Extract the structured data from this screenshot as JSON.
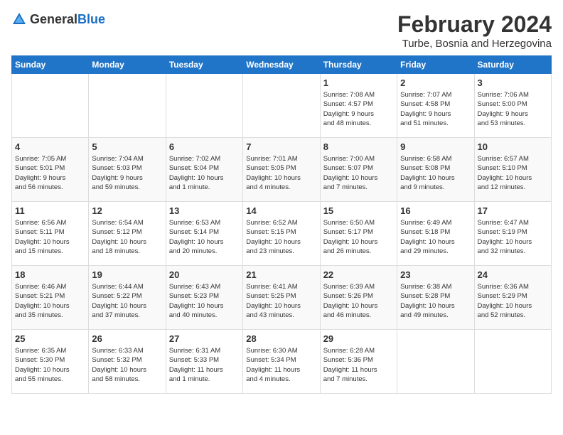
{
  "logo": {
    "general": "General",
    "blue": "Blue"
  },
  "title": "February 2024",
  "location": "Turbe, Bosnia and Herzegovina",
  "weekdays": [
    "Sunday",
    "Monday",
    "Tuesday",
    "Wednesday",
    "Thursday",
    "Friday",
    "Saturday"
  ],
  "weeks": [
    [
      {
        "day": "",
        "info": ""
      },
      {
        "day": "",
        "info": ""
      },
      {
        "day": "",
        "info": ""
      },
      {
        "day": "",
        "info": ""
      },
      {
        "day": "1",
        "info": "Sunrise: 7:08 AM\nSunset: 4:57 PM\nDaylight: 9 hours\nand 48 minutes."
      },
      {
        "day": "2",
        "info": "Sunrise: 7:07 AM\nSunset: 4:58 PM\nDaylight: 9 hours\nand 51 minutes."
      },
      {
        "day": "3",
        "info": "Sunrise: 7:06 AM\nSunset: 5:00 PM\nDaylight: 9 hours\nand 53 minutes."
      }
    ],
    [
      {
        "day": "4",
        "info": "Sunrise: 7:05 AM\nSunset: 5:01 PM\nDaylight: 9 hours\nand 56 minutes."
      },
      {
        "day": "5",
        "info": "Sunrise: 7:04 AM\nSunset: 5:03 PM\nDaylight: 9 hours\nand 59 minutes."
      },
      {
        "day": "6",
        "info": "Sunrise: 7:02 AM\nSunset: 5:04 PM\nDaylight: 10 hours\nand 1 minute."
      },
      {
        "day": "7",
        "info": "Sunrise: 7:01 AM\nSunset: 5:05 PM\nDaylight: 10 hours\nand 4 minutes."
      },
      {
        "day": "8",
        "info": "Sunrise: 7:00 AM\nSunset: 5:07 PM\nDaylight: 10 hours\nand 7 minutes."
      },
      {
        "day": "9",
        "info": "Sunrise: 6:58 AM\nSunset: 5:08 PM\nDaylight: 10 hours\nand 9 minutes."
      },
      {
        "day": "10",
        "info": "Sunrise: 6:57 AM\nSunset: 5:10 PM\nDaylight: 10 hours\nand 12 minutes."
      }
    ],
    [
      {
        "day": "11",
        "info": "Sunrise: 6:56 AM\nSunset: 5:11 PM\nDaylight: 10 hours\nand 15 minutes."
      },
      {
        "day": "12",
        "info": "Sunrise: 6:54 AM\nSunset: 5:12 PM\nDaylight: 10 hours\nand 18 minutes."
      },
      {
        "day": "13",
        "info": "Sunrise: 6:53 AM\nSunset: 5:14 PM\nDaylight: 10 hours\nand 20 minutes."
      },
      {
        "day": "14",
        "info": "Sunrise: 6:52 AM\nSunset: 5:15 PM\nDaylight: 10 hours\nand 23 minutes."
      },
      {
        "day": "15",
        "info": "Sunrise: 6:50 AM\nSunset: 5:17 PM\nDaylight: 10 hours\nand 26 minutes."
      },
      {
        "day": "16",
        "info": "Sunrise: 6:49 AM\nSunset: 5:18 PM\nDaylight: 10 hours\nand 29 minutes."
      },
      {
        "day": "17",
        "info": "Sunrise: 6:47 AM\nSunset: 5:19 PM\nDaylight: 10 hours\nand 32 minutes."
      }
    ],
    [
      {
        "day": "18",
        "info": "Sunrise: 6:46 AM\nSunset: 5:21 PM\nDaylight: 10 hours\nand 35 minutes."
      },
      {
        "day": "19",
        "info": "Sunrise: 6:44 AM\nSunset: 5:22 PM\nDaylight: 10 hours\nand 37 minutes."
      },
      {
        "day": "20",
        "info": "Sunrise: 6:43 AM\nSunset: 5:23 PM\nDaylight: 10 hours\nand 40 minutes."
      },
      {
        "day": "21",
        "info": "Sunrise: 6:41 AM\nSunset: 5:25 PM\nDaylight: 10 hours\nand 43 minutes."
      },
      {
        "day": "22",
        "info": "Sunrise: 6:39 AM\nSunset: 5:26 PM\nDaylight: 10 hours\nand 46 minutes."
      },
      {
        "day": "23",
        "info": "Sunrise: 6:38 AM\nSunset: 5:28 PM\nDaylight: 10 hours\nand 49 minutes."
      },
      {
        "day": "24",
        "info": "Sunrise: 6:36 AM\nSunset: 5:29 PM\nDaylight: 10 hours\nand 52 minutes."
      }
    ],
    [
      {
        "day": "25",
        "info": "Sunrise: 6:35 AM\nSunset: 5:30 PM\nDaylight: 10 hours\nand 55 minutes."
      },
      {
        "day": "26",
        "info": "Sunrise: 6:33 AM\nSunset: 5:32 PM\nDaylight: 10 hours\nand 58 minutes."
      },
      {
        "day": "27",
        "info": "Sunrise: 6:31 AM\nSunset: 5:33 PM\nDaylight: 11 hours\nand 1 minute."
      },
      {
        "day": "28",
        "info": "Sunrise: 6:30 AM\nSunset: 5:34 PM\nDaylight: 11 hours\nand 4 minutes."
      },
      {
        "day": "29",
        "info": "Sunrise: 6:28 AM\nSunset: 5:36 PM\nDaylight: 11 hours\nand 7 minutes."
      },
      {
        "day": "",
        "info": ""
      },
      {
        "day": "",
        "info": ""
      }
    ]
  ]
}
